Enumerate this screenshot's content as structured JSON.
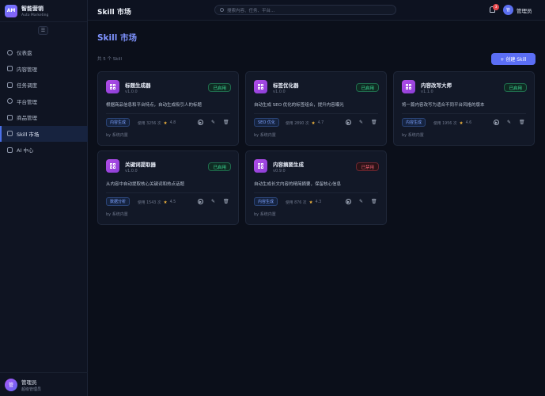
{
  "brand": {
    "logo": "AM",
    "title": "智能营销",
    "subtitle": "Auto Marketing"
  },
  "sidebar": {
    "items": [
      {
        "label": "仪表盘",
        "icon": "dashboard-icon"
      },
      {
        "label": "内容管理",
        "icon": "document-icon"
      },
      {
        "label": "任务调度",
        "icon": "calendar-icon"
      },
      {
        "label": "平台管理",
        "icon": "globe-icon"
      },
      {
        "label": "商品管理",
        "icon": "box-icon"
      },
      {
        "label": "Skill 市场",
        "icon": "grid-icon",
        "active": true
      },
      {
        "label": "AI 中心",
        "icon": "bot-icon"
      }
    ]
  },
  "user": {
    "avatar": "管",
    "name": "管理员",
    "role": "超级管理员"
  },
  "topbar": {
    "title": "Skill 市场",
    "search_placeholder": "搜索内容、任务、平台...",
    "notification_count": "3",
    "user_avatar": "管",
    "user_name": "管理员"
  },
  "main": {
    "title": "Skill 市场",
    "count_text": "共 5 个 Skill",
    "create_label": "+ 创建 Skill"
  },
  "cards": [
    {
      "name": "标题生成器",
      "version": "v1.0.0",
      "status": "已启用",
      "desc": "根据商品信息和平台特点，自动生成吸引人的标题",
      "tag": "内容生成",
      "usage": "使用 3256 次",
      "rating": "4.8",
      "author": "by 系统内置"
    },
    {
      "name": "标签优化器",
      "version": "v1.0.0",
      "status": "已启用",
      "desc": "自动生成 SEO 优化的标签组合，提升内容曝光",
      "tag": "SEO 优化",
      "usage": "使用 2890 次",
      "rating": "4.7",
      "author": "by 系统内置"
    },
    {
      "name": "内容改写大师",
      "version": "v1.1.0",
      "status": "已启用",
      "desc": "将一篇内容改写为适合不同平台风格的版本",
      "tag": "内容生成",
      "usage": "使用 1956 次",
      "rating": "4.6",
      "author": "by 系统内置"
    },
    {
      "name": "关键词提取器",
      "version": "v1.0.0",
      "status": "已启用",
      "desc": "从内容中自动提取核心关键词和热点话题",
      "tag": "数据分析",
      "usage": "使用 1543 次",
      "rating": "4.5",
      "author": "by 系统内置"
    },
    {
      "name": "内容摘要生成",
      "version": "v0.9.0",
      "status": "已禁用",
      "desc": "自动生成长文内容的精简摘要，保留核心信息",
      "tag": "内容生成",
      "usage": "使用 876 次",
      "rating": "4.3",
      "author": "by 系统内置"
    }
  ],
  "colors": {
    "accent": "#5b6ef5",
    "enabled": "#3ddc97",
    "disabled": "#f06272",
    "tag": "#7ea2ff"
  }
}
